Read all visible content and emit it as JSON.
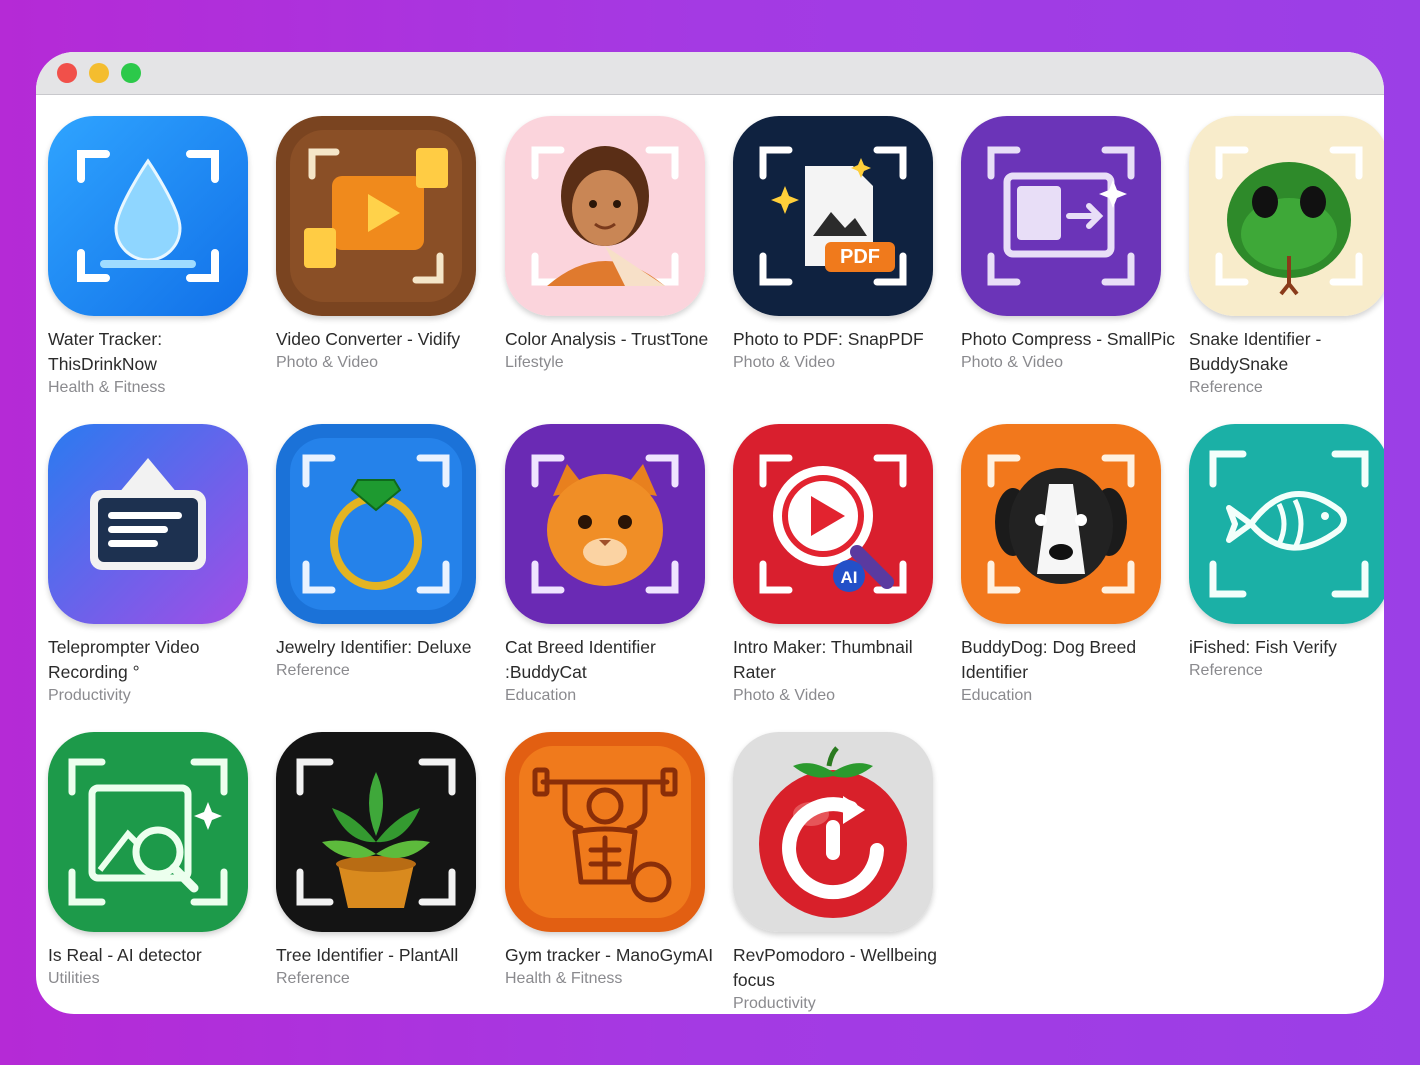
{
  "window": {
    "controls": [
      "close",
      "minimize",
      "zoom"
    ]
  },
  "apps": [
    {
      "name": "Water Tracker: ThisDrinkNow",
      "category": "Health & Fitness",
      "icon": "water-drop-icon"
    },
    {
      "name": "Video Converter - Vidify",
      "category": "Photo & Video",
      "icon": "video-convert-icon"
    },
    {
      "name": "Color Analysis - TrustTone",
      "category": "Lifestyle",
      "icon": "face-palette-icon"
    },
    {
      "name": "Photo to PDF: SnapPDF",
      "category": "Photo & Video",
      "icon": "pdf-document-icon",
      "badge": "PDF"
    },
    {
      "name": "Photo Compress - SmallPic",
      "category": "Photo & Video",
      "icon": "photo-compress-icon"
    },
    {
      "name": "Snake Identifier - BuddySnake",
      "category": "Reference",
      "icon": "snake-icon"
    },
    {
      "name": "Teleprompter Video Recording °",
      "category": "Productivity",
      "icon": "teleprompter-icon"
    },
    {
      "name": "Jewelry Identifier: Deluxe",
      "category": "Reference",
      "icon": "ring-icon"
    },
    {
      "name": "Cat Breed Identifier :BuddyCat",
      "category": "Education",
      "icon": "cat-icon"
    },
    {
      "name": "Intro Maker: Thumbnail Rater",
      "category": "Photo & Video",
      "icon": "play-magnifier-icon",
      "badge": "AI"
    },
    {
      "name": "BuddyDog: Dog Breed Identifier",
      "category": "Education",
      "icon": "dog-icon"
    },
    {
      "name": "iFished: Fish Verify",
      "category": "Reference",
      "icon": "fish-icon"
    },
    {
      "name": "Is Real - AI detector",
      "category": "Utilities",
      "icon": "image-search-icon"
    },
    {
      "name": "Tree Identifier - PlantAll",
      "category": "Reference",
      "icon": "potted-plant-icon"
    },
    {
      "name": "Gym tracker - ManoGymAI",
      "category": "Health & Fitness",
      "icon": "bodybuilder-icon"
    },
    {
      "name": "RevPomodoro - Wellbeing focus",
      "category": "Productivity",
      "icon": "tomato-timer-icon"
    }
  ],
  "colors": {
    "background_gradient": [
      "#b52ad6",
      "#9b3fe6"
    ],
    "window": "#ffffff",
    "titlebar": "#e4e4e6",
    "title_text": "#2b2b2b",
    "category_text": "#8a8a8e"
  }
}
